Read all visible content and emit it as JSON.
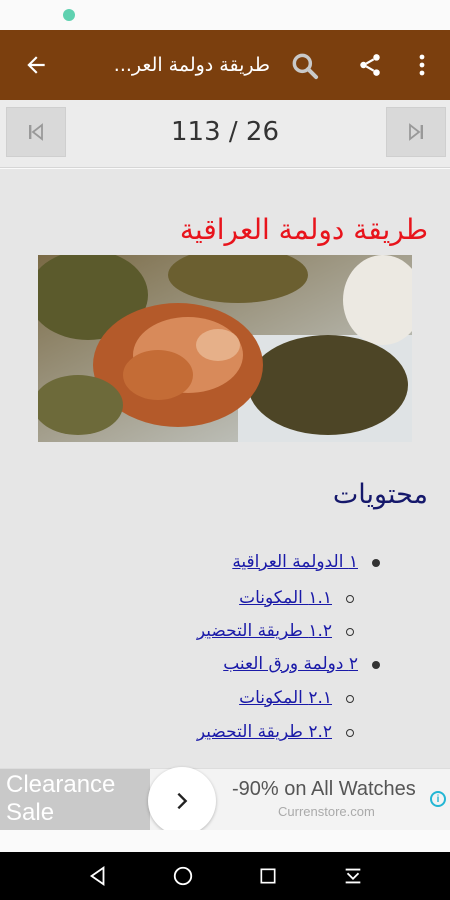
{
  "app_bar": {
    "title": "طريقة دولمة العر...",
    "icons": [
      "back-arrow-icon",
      "search-icon",
      "share-icon",
      "more-vert-icon"
    ],
    "color": "#7b3f0e"
  },
  "pager": {
    "counter": "113 / 26",
    "icons": [
      "skip-previous-icon",
      "skip-next-icon"
    ]
  },
  "article": {
    "title": "طريقة دولمة العراقية",
    "title_color": "#e8141c",
    "toc_title": "محتويات",
    "toc": [
      {
        "label": "١ الدولمة العراقية",
        "level": 1
      },
      {
        "label": "١.١ المكونات",
        "level": 2
      },
      {
        "label": "١.٢ طريقة التحضير",
        "level": 2
      },
      {
        "label": "٢ دولمة ورق العنب",
        "level": 1
      },
      {
        "label": "٢.١ المكونات",
        "level": 2
      },
      {
        "label": "٢.٢ طريقة التحضير",
        "level": 2
      }
    ]
  },
  "ad": {
    "left_line1": "Clearance",
    "left_line2": "Sale",
    "headline": "-90% on All Watches",
    "url": "Currenstore.com",
    "adchoices": "i"
  },
  "navbar": {
    "icons": [
      "back-triangle-icon",
      "home-circle-icon",
      "recents-square-icon",
      "hide-keyboard-icon"
    ]
  }
}
